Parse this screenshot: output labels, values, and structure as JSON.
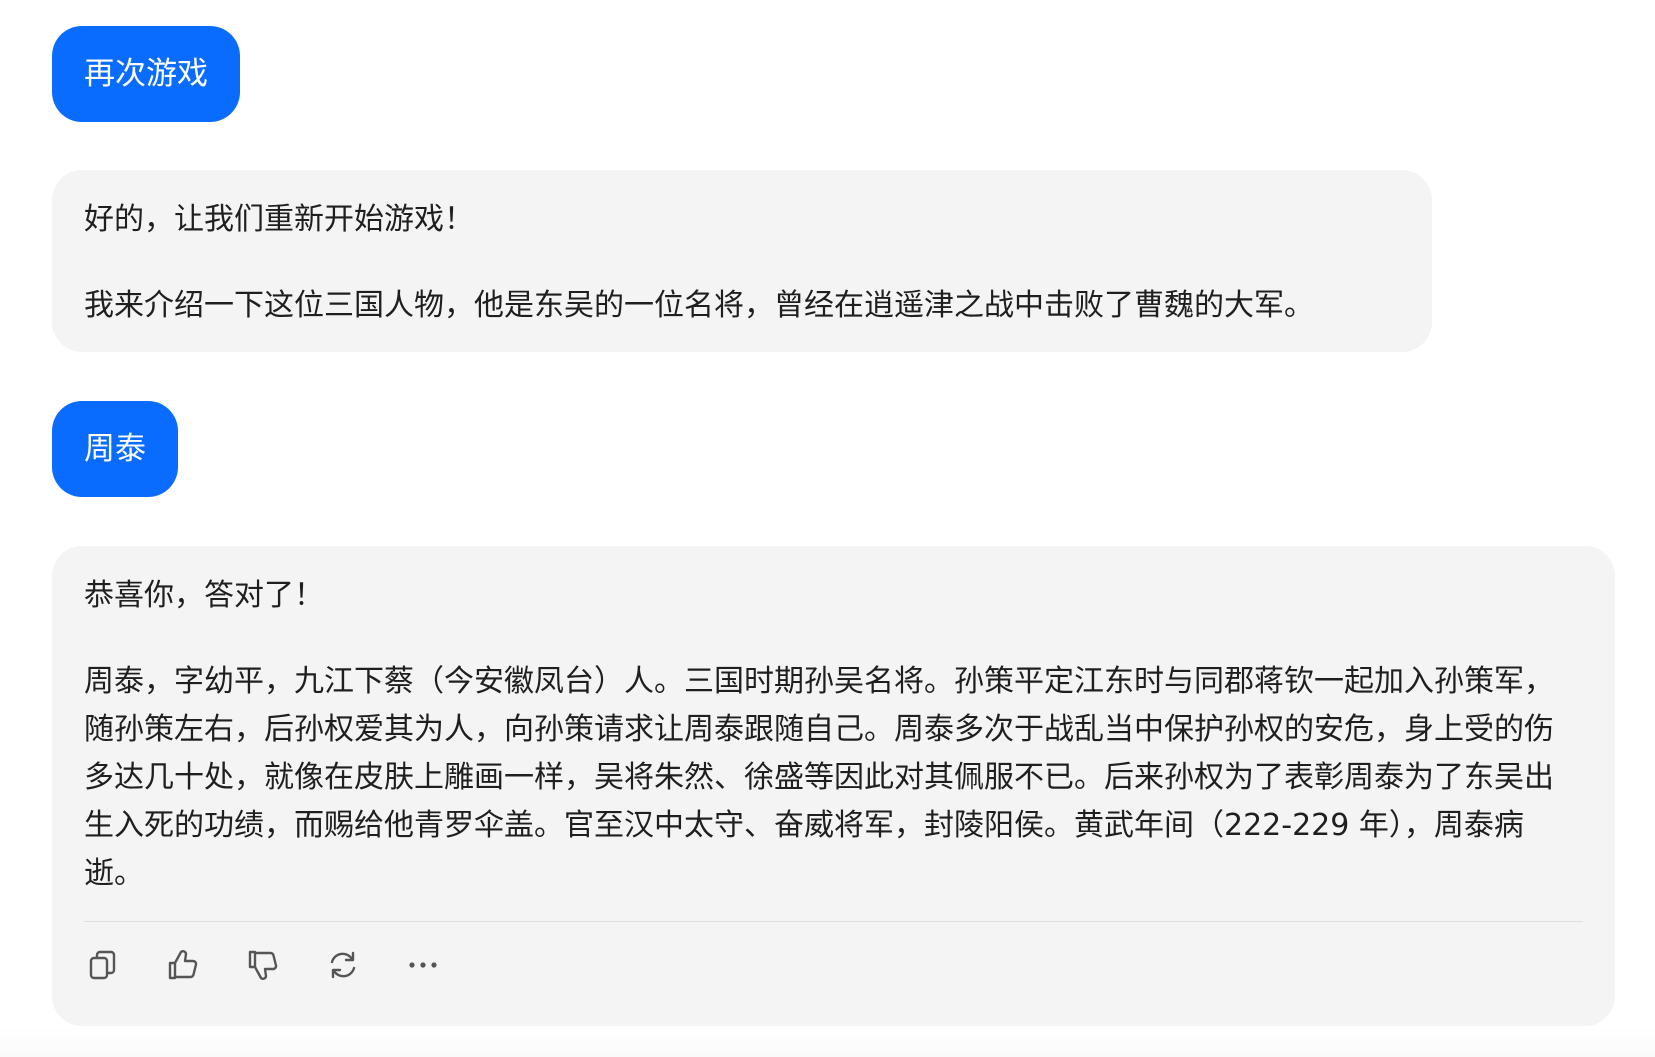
{
  "messages": {
    "user_1": "再次游戏",
    "bot_1": {
      "line_1": "好的，让我们重新开始游戏！",
      "line_2": "我来介绍一下这位三国人物，他是东吴的一位名将，曾经在逍遥津之战中击败了曹魏的大军。"
    },
    "user_2": "周泰",
    "bot_2": {
      "line_1": "恭喜你，答对了！",
      "paragraph": "周泰，字幼平，九江下蔡（今安徽凤台）人。三国时期孙吴名将。孙策平定江东时与同郡蒋钦一起加入孙策军，随孙策左右，后孙权爱其为人，向孙策请求让周泰跟随自己。周泰多次于战乱当中保护孙权的安危，身上受的伤多达几十处，就像在皮肤上雕画一样，吴将朱然、徐盛等因此对其佩服不已。后来孙权为了表彰周泰为了东吴出生入死的功绩，而赐给他青罗伞盖。官至汉中太守、奋威将军，封陵阳侯。黄武年间（222-229 年），周泰病逝。"
    }
  },
  "actions": [
    "copy-icon",
    "thumbs-up-icon",
    "thumbs-down-icon",
    "regenerate-icon",
    "more-icon"
  ],
  "colors": {
    "accent": "#0a6cff",
    "bubble_bg": "#f4f4f4"
  }
}
